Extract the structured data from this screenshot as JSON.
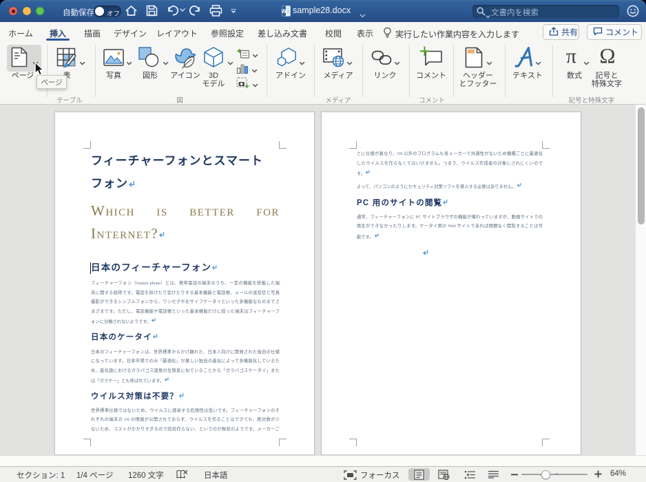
{
  "window": {
    "title": "sample28.docx",
    "autosave_label": "自動保存",
    "autosave_state": "オフ",
    "search_placeholder": "文書内を検索"
  },
  "tabs": [
    "ホーム",
    "挿入",
    "描画",
    "デザイン",
    "レイアウト",
    "参照設定",
    "差し込み文書",
    "校閲",
    "表示"
  ],
  "active_tab": "挿入",
  "assistant_hint": "実行したい作業内容を入力します",
  "share_label": "共有",
  "comments_label": "コメント",
  "ribbon": {
    "buttons": {
      "page": "ページ",
      "table": "表",
      "photo": "写真",
      "shapes": "図形",
      "icons": "アイコン",
      "model3d_1": "3D",
      "model3d_2": "モデル",
      "addins": "アドイン",
      "media": "メディア",
      "link": "リンク",
      "comment": "コメント",
      "header_1": "ヘッダー",
      "header_2": "とフッター",
      "text": "テキスト",
      "equation": "数式",
      "symbol_1": "記号と",
      "symbol_2": "特殊文字"
    },
    "groups": {
      "table": "テーブル",
      "illustrations": "図",
      "media": "メディア",
      "comments": "コメント",
      "symbols": "記号と特殊文字"
    },
    "tooltip": "ページ",
    "equation_glyph": "π",
    "symbol_glyph": "Ω"
  },
  "doc": {
    "page1": {
      "title": [
        "フィーチャーフォンとスマート",
        "フォン"
      ],
      "subtitle": [
        "Which is better for",
        "Internet?"
      ],
      "h1": "日本のフィーチャーフォン",
      "p1": [
        "フィーチャーフォン（feature phone）とは、携帯電話の端末のうち、一定の機能を搭載した端",
        "末に関する総称です。電話を掛けたり受けたりする基本機能と電話帳、メールの送受信と写真",
        "撮影ができるシンプルフォンから、ワンセグやおサイフケータイといった多機能なものまでさ",
        "まざまです。ただし、電話機能や電話帳といった基本機能だけに絞った端末はフィーチャーフ",
        "ォンに分類されないようです。"
      ],
      "h2": "日本のケータイ",
      "p2": [
        "日本のフィーチャーフォンは、世界標準からかけ離れた、日本人向けに開発された独自の仕様",
        "になっています。日本市場でのみ「最適化」が著しい独自の進化によって多機能化しているた",
        "め、進化論におけるガラパゴス諸島の生態系に似ていることから「ガラパゴスケータイ」また",
        "は「ガラケー」とも呼ばれています。"
      ],
      "h3": "ウイルス対策は不要？",
      "p3": [
        "世界標準仕様ではないため、ウイルスに感染する危険性は低いです。フィーチャーフォンのそ",
        "れぞれの端末の OS の情報が公開されておらず、ウイルスを作ることはできても、絶対数が少",
        "ないため、コストがかかりすぎるので結局作らない、というのが現状のようです。メーカーご"
      ]
    },
    "page2": {
      "p1": [
        "とに仕様が異なり、OS 以外のプログラムも各メーカーで共通性がないため機種ごとに最適化",
        "したウイルスを作らなくてはいけません。つまり、ウイルス作成者の対象にされにくいので",
        "す。"
      ],
      "p2": "よって、パソコンのようにセキュリティ対策ソフトを導入する必要はありません。",
      "h1": "PC 用のサイトの閲覧",
      "p3": [
        "通常、フィーチャーフォンに PC サイトブラウザの機能が備わっていますが、動画サイトでの",
        "再生ができなかったりします。ケータイ用の Web サイトであれば問題なく閲覧することは可",
        "能です。"
      ]
    }
  },
  "status_bar": {
    "section": "セクション: 1",
    "page": "1/4 ページ",
    "chars": "1260 文字",
    "language": "日本語",
    "focus": "フォーカス",
    "zoom": "64%"
  }
}
